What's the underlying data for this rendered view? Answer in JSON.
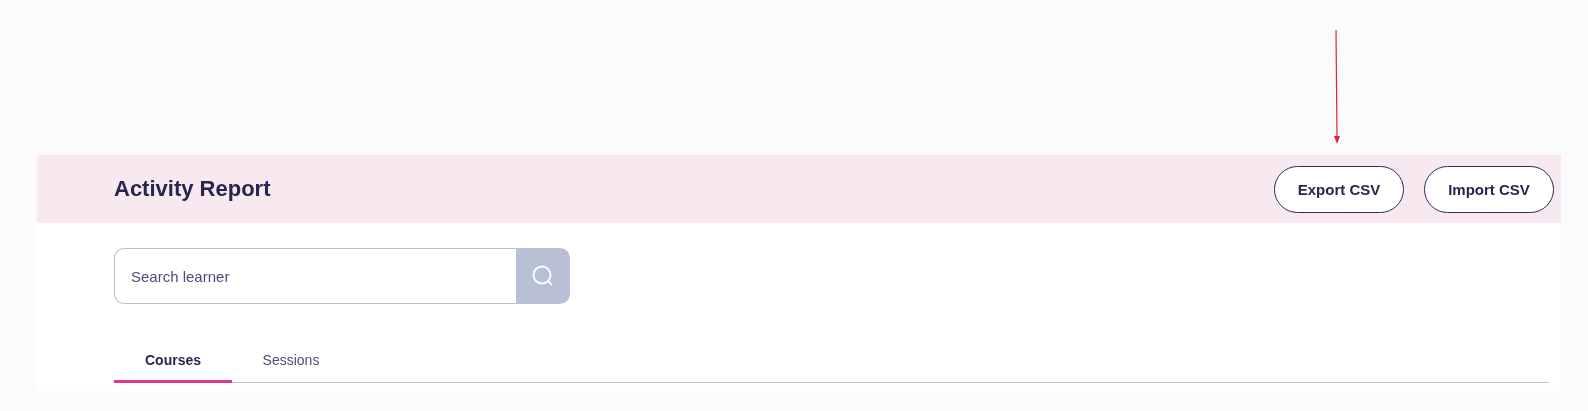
{
  "header": {
    "title": "Activity Report",
    "buttons": [
      "Export CSV",
      "Import CSV"
    ]
  },
  "search": {
    "placeholder": "Search learner"
  },
  "tabs": [
    {
      "label": "Courses",
      "selected": true
    },
    {
      "label": "Sessions",
      "selected": false
    }
  ]
}
